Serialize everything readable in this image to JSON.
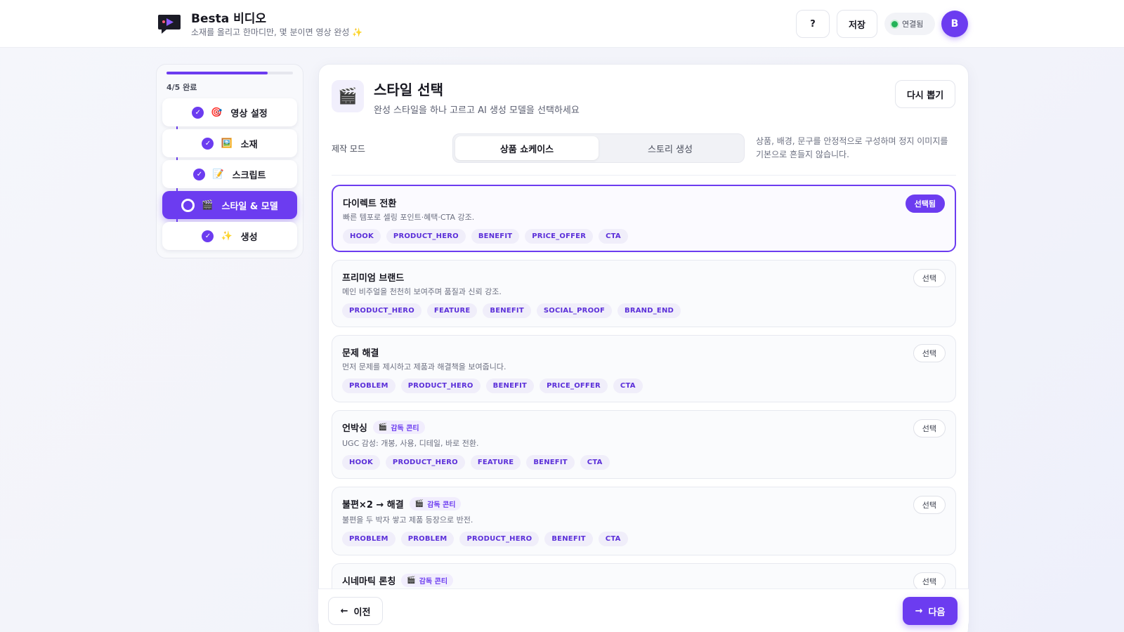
{
  "header": {
    "app_title": "Besta 비디오",
    "app_subtitle": "소재를 올리고 한마디만, 몇 분이면 영상 완성 ✨",
    "help_label": "?",
    "save_label": "저장",
    "connection_status": "연결됨",
    "avatar_initial": "B",
    "logo_icon": "chat-play-logo",
    "status_color": "#22b358"
  },
  "progress": {
    "label": "4/5 완료",
    "fraction": 0.8
  },
  "steps": [
    {
      "label": "영상 설정",
      "emoji": "🎯",
      "state": "done"
    },
    {
      "label": "소재",
      "emoji": "🖼️",
      "state": "done"
    },
    {
      "label": "스크립트",
      "emoji": "📝",
      "state": "done"
    },
    {
      "label": "스타일 & 모델",
      "emoji": "🎬",
      "state": "active"
    },
    {
      "label": "생성",
      "emoji": "✨",
      "state": "done"
    }
  ],
  "main": {
    "title_emoji": "🎬",
    "title": "스타일 선택",
    "subtitle": "완성 스타일을 하나 고르고 AI 생성 모델을 선택하세요",
    "reroll_label": "다시 뽑기",
    "mode_label": "제작 모드",
    "modes": [
      {
        "label": "상품 쇼케이스",
        "selected": true
      },
      {
        "label": "스토리 생성",
        "selected": false
      }
    ],
    "mode_description": "상품, 배경, 문구를 안정적으로 구성하며 정지 이미지를 기본으로 흔들지 않습니다.",
    "accent_color": "#6c3cf0"
  },
  "styles": [
    {
      "name": "다이렉트 전환",
      "badge": "",
      "description": "빠른 템포로 셀링 포인트·혜택·CTA 강조.",
      "tags": [
        "HOOK",
        "PRODUCT_HERO",
        "BENEFIT",
        "PRICE_OFFER",
        "CTA"
      ],
      "button": "선택됨",
      "selected": true
    },
    {
      "name": "프리미엄 브랜드",
      "badge": "",
      "description": "메인 비주얼을 천천히 보여주며 품질과 신뢰 강조.",
      "tags": [
        "PRODUCT_HERO",
        "FEATURE",
        "BENEFIT",
        "SOCIAL_PROOF",
        "BRAND_END"
      ],
      "button": "선택",
      "selected": false
    },
    {
      "name": "문제 해결",
      "badge": "",
      "description": "먼저 문제를 제시하고 제품과 해결책을 보여줍니다.",
      "tags": [
        "PROBLEM",
        "PRODUCT_HERO",
        "BENEFIT",
        "PRICE_OFFER",
        "CTA"
      ],
      "button": "선택",
      "selected": false
    },
    {
      "name": "언박싱",
      "badge": "감독 콘티",
      "description": "UGC 감성: 개봉, 사용, 디테일, 바로 전환.",
      "tags": [
        "HOOK",
        "PRODUCT_HERO",
        "FEATURE",
        "BENEFIT",
        "CTA"
      ],
      "button": "선택",
      "selected": false
    },
    {
      "name": "불편×2 → 해결",
      "badge": "감독 콘티",
      "description": "불편을 두 박자 쌓고 제품 등장으로 반전.",
      "tags": [
        "PROBLEM",
        "PROBLEM",
        "PRODUCT_HERO",
        "BENEFIT",
        "CTA"
      ],
      "button": "선택",
      "selected": false
    },
    {
      "name": "시네마틱 론칭",
      "badge": "감독 콘티",
      "description": "",
      "tags": [],
      "button": "선택",
      "selected": false
    }
  ],
  "footer": {
    "prev_label": "이전",
    "next_label": "다음"
  }
}
